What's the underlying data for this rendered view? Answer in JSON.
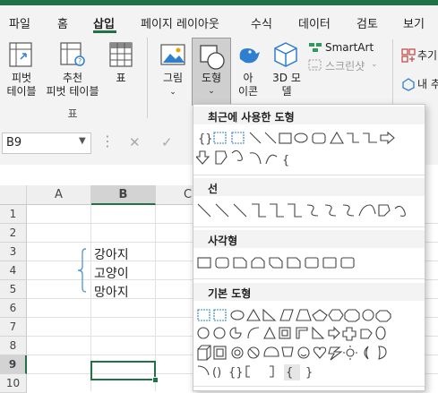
{
  "tabs": [
    {
      "label": "파일",
      "active": false
    },
    {
      "label": "홈",
      "active": false
    },
    {
      "label": "삽입",
      "active": true
    },
    {
      "label": "페이지 레이아웃",
      "active": false
    },
    {
      "label": "수식",
      "active": false
    },
    {
      "label": "데이터",
      "active": false
    },
    {
      "label": "검토",
      "active": false
    },
    {
      "label": "보기",
      "active": false
    }
  ],
  "ribbon": {
    "pivot_table": "피벗\n테이블",
    "recommended_pivot": "추천\n피벗 테이블",
    "table": "표",
    "group_tables": "표",
    "picture": "그림",
    "shapes": "도형",
    "icons": "아\n이콘",
    "models3d": "3D 모\n델",
    "smartart": "SmartArt",
    "screenshot": "스크린샷",
    "addins": "추기",
    "my_addins": "내 추"
  },
  "formula_bar": {
    "name_box": "B9"
  },
  "sheet": {
    "columns": [
      "A",
      "B",
      "C"
    ],
    "rows": [
      "1",
      "2",
      "3",
      "4",
      "5",
      "6",
      "7",
      "8",
      "9",
      "10"
    ],
    "cells": {
      "B3": "강아지",
      "B4": "고양이",
      "B5": "망아지"
    },
    "selected_cell": "B9"
  },
  "shapes_menu": {
    "recent_title": "최근에 사용한 도형",
    "lines_title": "선",
    "rect_title": "사각형",
    "basic_title": "기본 도형"
  },
  "colors": {
    "accent": "#217346",
    "ribbon_bg": "#f3f3f3",
    "icon_blue": "#2f7fd0"
  }
}
